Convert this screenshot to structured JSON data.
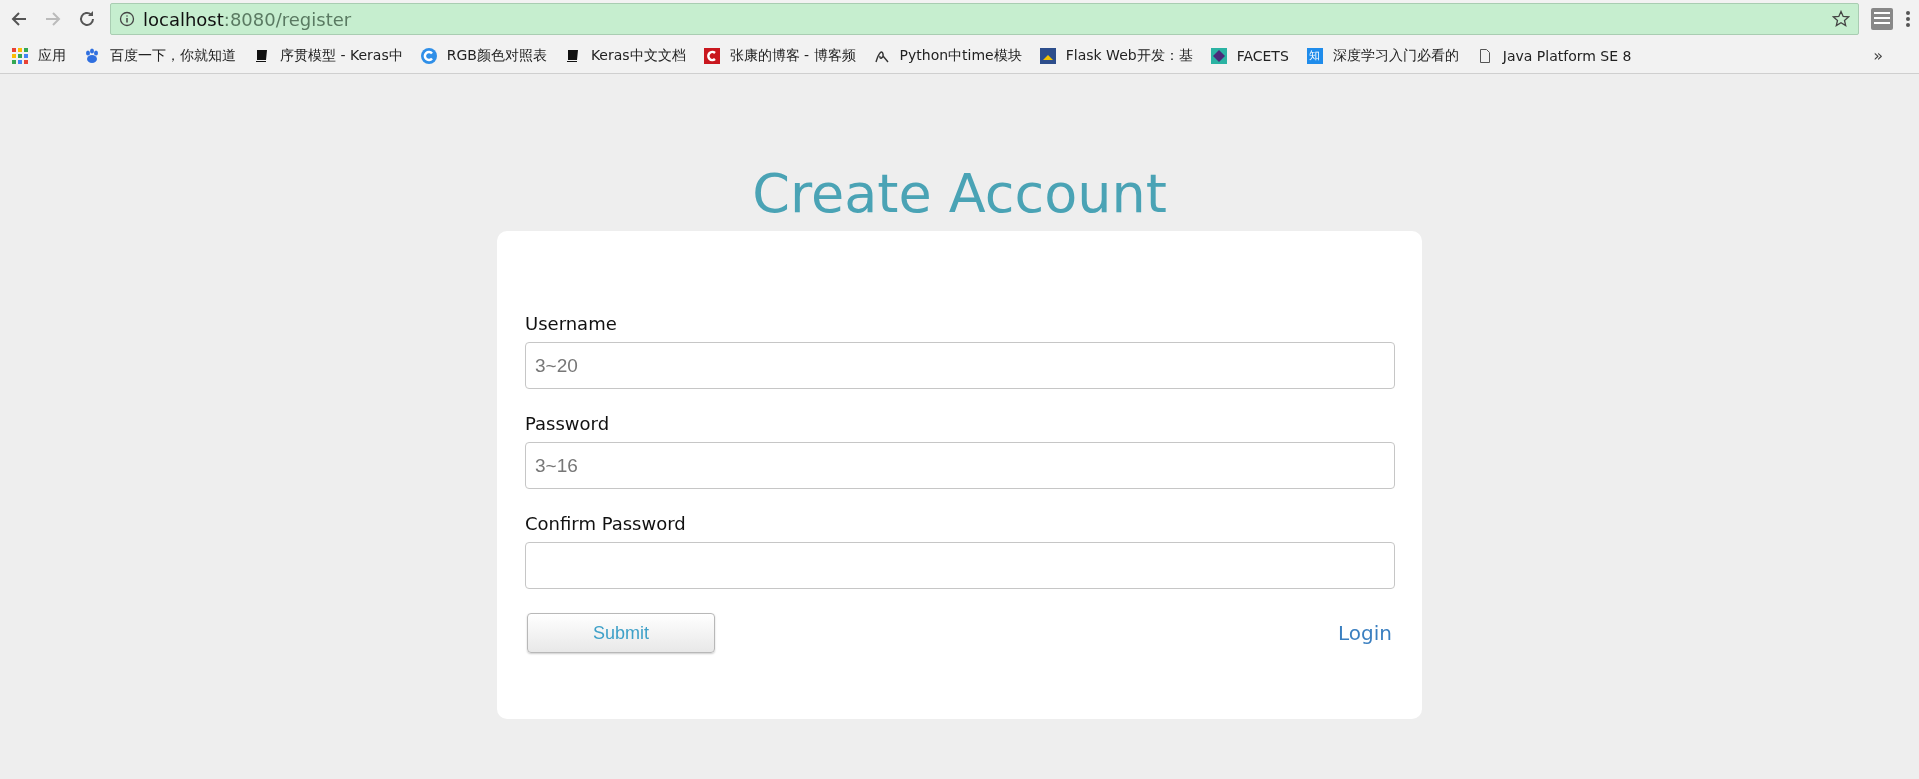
{
  "browser": {
    "url_host": "localhost",
    "url_path": ":8080/register"
  },
  "bookmarks": [
    {
      "kind": "apps",
      "label": "应用"
    },
    {
      "kind": "paw",
      "label": "百度一下，你就知道"
    },
    {
      "kind": "book",
      "label": "序贯模型 - Keras中"
    },
    {
      "kind": "c-circle",
      "label": "RGB颜色对照表"
    },
    {
      "kind": "book",
      "label": "Keras中文文档"
    },
    {
      "kind": "c-square",
      "label": "张康的博客 - 博客频"
    },
    {
      "kind": "script",
      "label": "Python中time模块"
    },
    {
      "kind": "flask",
      "label": "Flask Web开发：基"
    },
    {
      "kind": "diamond",
      "label": "FACETS"
    },
    {
      "kind": "zhi",
      "label": "深度学习入门必看的",
      "icon_text": "知"
    },
    {
      "kind": "page",
      "label": "Java Platform SE 8"
    }
  ],
  "more_bookmarks": "»",
  "title": "Create Account",
  "fields": [
    {
      "label": "Username",
      "placeholder": "3~20"
    },
    {
      "label": "Password",
      "placeholder": "3~16"
    },
    {
      "label": "Confirm Password"
    }
  ],
  "submit": "Submit",
  "login": "Login"
}
